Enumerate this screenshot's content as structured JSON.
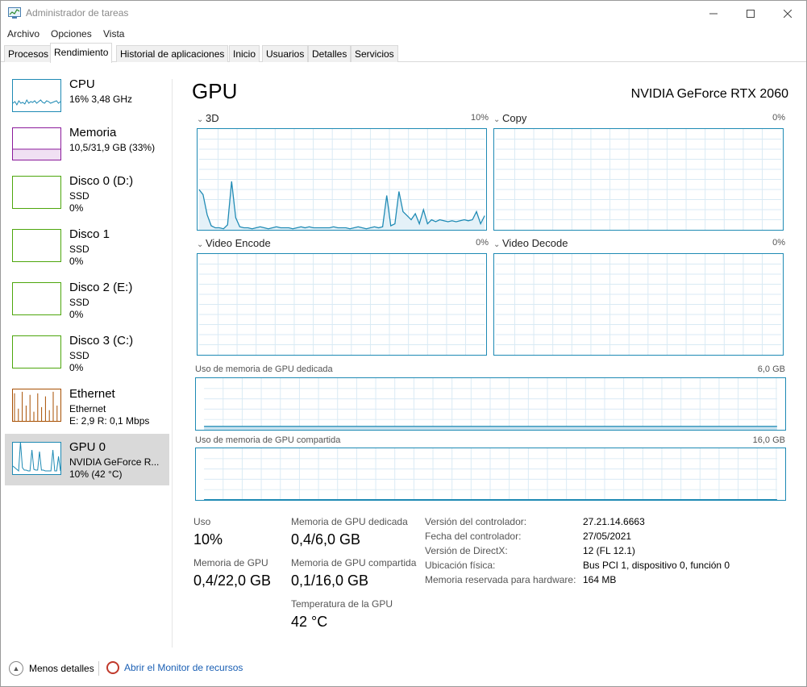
{
  "window": {
    "title": "Administrador de tareas",
    "minimize_icon": "minimize-icon",
    "maximize_icon": "maximize-icon",
    "close_icon": "close-icon"
  },
  "menu": [
    "Archivo",
    "Opciones",
    "Vista"
  ],
  "tabs": [
    {
      "label": "Procesos",
      "active": false
    },
    {
      "label": "Rendimiento",
      "active": true
    },
    {
      "label": "Historial de aplicaciones",
      "active": false
    },
    {
      "label": "Inicio",
      "active": false
    },
    {
      "label": "Usuarios",
      "active": false
    },
    {
      "label": "Detalles",
      "active": false
    },
    {
      "label": "Servicios",
      "active": false
    }
  ],
  "sidebar": {
    "items": [
      {
        "name": "CPU",
        "line1": "16%  3,48 GHz",
        "line2": "",
        "color": "#1e8ab4",
        "selected": false
      },
      {
        "name": "Memoria",
        "line1": "10,5/31,9 GB (33%)",
        "line2": "",
        "color": "#8b1a9b",
        "selected": false
      },
      {
        "name": "Disco 0 (D:)",
        "line1": "SSD",
        "line2": "0%",
        "color": "#4da60c",
        "selected": false
      },
      {
        "name": "Disco 1",
        "line1": "SSD",
        "line2": "0%",
        "color": "#4da60c",
        "selected": false
      },
      {
        "name": "Disco 2 (E:)",
        "line1": "SSD",
        "line2": "0%",
        "color": "#4da60c",
        "selected": false
      },
      {
        "name": "Disco 3 (C:)",
        "line1": "SSD",
        "line2": "0%",
        "color": "#4da60c",
        "selected": false
      },
      {
        "name": "Ethernet",
        "line1": "Ethernet",
        "line2": "E: 2,9  R: 0,1 Mbps",
        "color": "#a74f01",
        "selected": false
      },
      {
        "name": "GPU 0",
        "line1": "NVIDIA GeForce R...",
        "line2": "10%  (42 °C)",
        "color": "#1e8ab4",
        "selected": true
      }
    ]
  },
  "main": {
    "title": "GPU",
    "model": "NVIDIA GeForce RTX 2060",
    "engines": [
      {
        "label": "3D",
        "pct": "10%",
        "history": [
          40,
          35,
          15,
          4,
          2,
          2,
          1,
          5,
          48,
          12,
          3,
          2,
          2,
          1,
          2,
          3,
          2,
          1,
          2,
          3,
          2,
          2,
          2,
          1,
          2,
          3,
          2,
          3,
          2,
          2,
          2,
          2,
          2,
          3,
          2,
          2,
          2,
          1,
          2,
          3,
          2,
          1,
          2,
          3,
          2,
          3,
          34,
          4,
          6,
          38,
          18,
          14,
          10,
          16,
          6,
          20,
          6,
          10,
          8,
          10,
          9,
          8,
          9,
          8,
          9,
          10,
          9,
          10,
          18,
          6,
          14
        ]
      },
      {
        "label": "Copy",
        "pct": "0%",
        "history": []
      },
      {
        "label": "Video Encode",
        "pct": "0%",
        "history": []
      },
      {
        "label": "Video Decode",
        "pct": "0%",
        "history": []
      }
    ],
    "dedicated_mem": {
      "label": "Uso de memoria de GPU dedicada",
      "max": "6,0 GB",
      "fill_fraction": 0.067
    },
    "shared_mem": {
      "label": "Uso de memoria de GPU compartida",
      "max": "16,0 GB",
      "fill_fraction": 0.006
    },
    "stats": {
      "usage_label": "Uso",
      "usage_value": "10%",
      "gpu_mem_label": "Memoria de GPU",
      "gpu_mem_value": "0,4/22,0 GB",
      "ded_label": "Memoria de GPU dedicada",
      "ded_value": "0,4/6,0 GB",
      "shared_label": "Memoria de GPU compartida",
      "shared_value": "0,1/16,0 GB",
      "temp_label": "Temperatura de la GPU",
      "temp_value": "42 °C"
    },
    "details": [
      {
        "label": "Versión del controlador:",
        "value": "27.21.14.6663"
      },
      {
        "label": "Fecha del controlador:",
        "value": "27/05/2021"
      },
      {
        "label": "Versión de DirectX:",
        "value": "12 (FL 12.1)"
      },
      {
        "label": "Ubicación física:",
        "value": "Bus PCI 1, dispositivo 0, función 0"
      },
      {
        "label": "Memoria reservada para hardware:",
        "value": "164 MB"
      }
    ]
  },
  "footer": {
    "less_details": "Menos detalles",
    "resource_monitor": "Abrir el Monitor de recursos"
  }
}
